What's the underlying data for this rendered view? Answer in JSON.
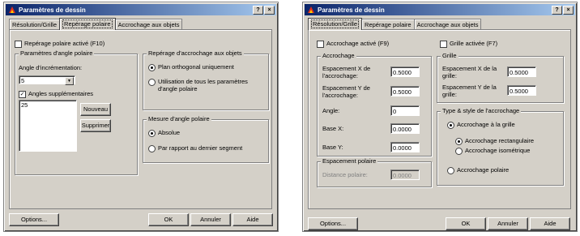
{
  "dialog1": {
    "title": "Paramètres de dessin",
    "tabs": [
      "Résolution/Grille",
      "Repérage polaire",
      "Accrochage aux objets"
    ],
    "polar_tracking_check": "Repérage polaire activé (F10)",
    "angle_group": "Paramètres d'angle polaire",
    "increment_label": "Angle d'incrémentation:",
    "increment_value": "5",
    "additional_angles_check": "Angles supplémentaires",
    "angles_list": [
      "25"
    ],
    "new_button": "Nouveau",
    "delete_button": "Supprimer",
    "osnap_group": "Repérage d'accrochage aux objets",
    "osnap_opt1": "Plan orthogonal uniquement",
    "osnap_opt2": "Utilisation de tous les paramètres d'angle polaire",
    "measure_group": "Mesure d'angle polaire",
    "measure_opt1": "Absolue",
    "measure_opt2": "Par rapport au dernier segment",
    "options_button": "Options...",
    "ok_button": "OK",
    "cancel_button": "Annuler",
    "help_button": "Aide"
  },
  "dialog2": {
    "title": "Paramètres de dessin",
    "tabs": [
      "Résolution/Grille",
      "Repérage polaire",
      "Accrochage aux objets"
    ],
    "snap_check": "Accrochage activé (F9)",
    "grid_check": "Grille activée (F7)",
    "snap_group": "Accrochage",
    "snap_x_label": "Espacement X de l'accrochage:",
    "snap_x_value": "0.5000",
    "snap_y_label": "Espacement Y de l'accrochage:",
    "snap_y_value": "0.5000",
    "angle_label": "Angle:",
    "angle_value": "0",
    "base_x_label": "Base X:",
    "base_x_value": "0.0000",
    "base_y_label": "Base Y:",
    "base_y_value": "0.0000",
    "polar_spacing_group": "Espacement polaire",
    "polar_distance_label": "Distance polaire:",
    "polar_distance_value": "0.0000",
    "grid_group": "Grille",
    "grid_x_label": "Espacement X de la grille:",
    "grid_x_value": "0.5000",
    "grid_y_label": "Espacement Y de la grille:",
    "grid_y_value": "0.5000",
    "type_group": "Type & style de l'accrochage",
    "type_grid": "Accrochage à la grille",
    "type_rect": "Accrochage rectangulaire",
    "type_iso": "Accrochage isométrique",
    "type_polar": "Accrochage polaire",
    "options_button": "Options...",
    "ok_button": "OK",
    "cancel_button": "Annuler",
    "help_button": "Aide"
  },
  "titlebar_buttons": [
    "?",
    "×"
  ]
}
